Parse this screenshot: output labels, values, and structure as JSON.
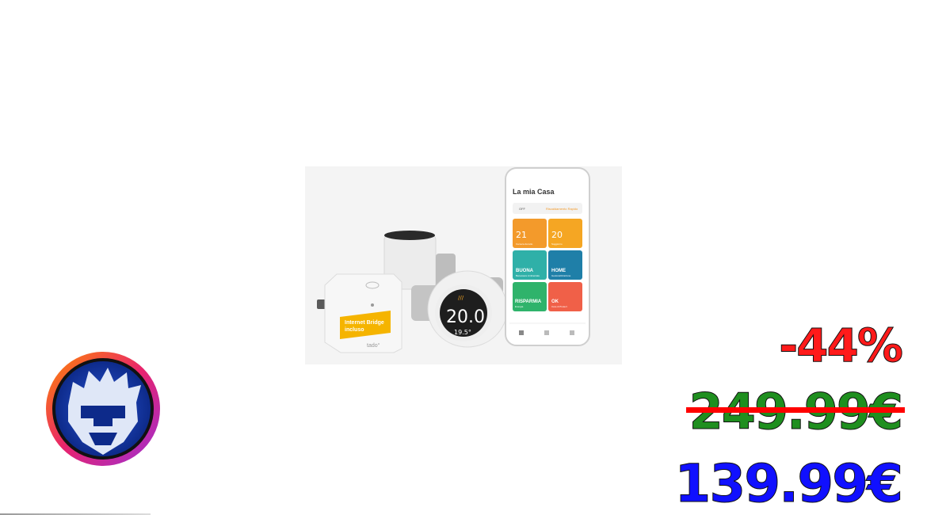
{
  "product": {
    "app_title": "La mia Casa",
    "status_left": "OFF",
    "status_right": "Riscaldamento Rapido",
    "bridge_label_line1": "Internet Bridge",
    "bridge_label_line2": "incluso",
    "bridge_brand": "tado°",
    "thermostat_temp": "20.0",
    "thermostat_sub": "19.5°",
    "tiles": [
      {
        "big": "21",
        "small": "Camera da letto",
        "color": "#f39a2b"
      },
      {
        "big": "20",
        "small": "Soggiorno",
        "color": "#f5a623"
      },
      {
        "big": "BUONA",
        "small": "Benessere Ambientale",
        "color": "#2fb0a8"
      },
      {
        "big": "HOME",
        "small": "Geolocalizzazione",
        "color": "#1f7fa8"
      },
      {
        "big": "RISPARMIA",
        "small": "Energia",
        "color": "#2fb36b"
      },
      {
        "big": "OK",
        "small": "Care & Protect",
        "color": "#f06048"
      }
    ]
  },
  "pricing": {
    "discount": "-44%",
    "old_price": "249.99€",
    "new_price": "139.99€"
  },
  "colors": {
    "discount": "#ff1a1a",
    "old_price": "#1f8f1f",
    "new_price": "#1010ff"
  }
}
